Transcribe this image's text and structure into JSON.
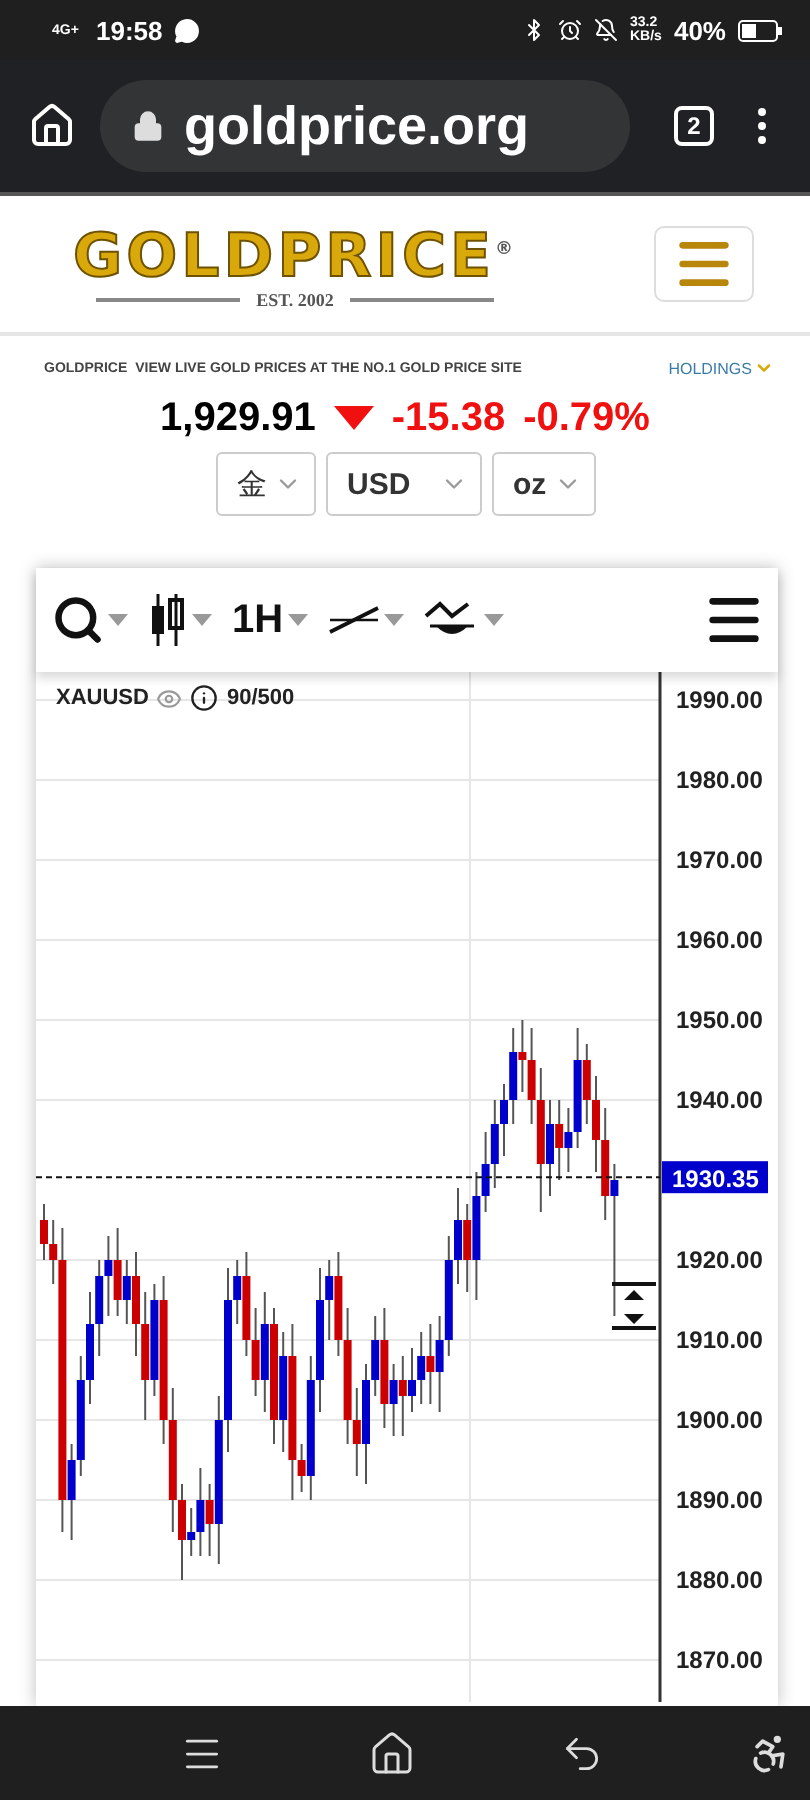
{
  "status_bar": {
    "network": "4G+",
    "time": "19:58",
    "speed": "33.2 KB/s",
    "battery": "40%"
  },
  "browser": {
    "url": "goldprice.org",
    "tab_count": "2"
  },
  "logo": {
    "name": "GOLDPRICE",
    "mark": "®",
    "tagline": "EST. 2002"
  },
  "ticker": {
    "brand": "GOLDPRICE",
    "tagline": "VIEW LIVE GOLD PRICES AT THE NO.1 GOLD PRICE SITE",
    "holdings": "HOLDINGS"
  },
  "quote": {
    "price": "1,929.91",
    "change": "-15.38",
    "percent": "-0.79%"
  },
  "selectors": [
    {
      "value": "金"
    },
    {
      "value": "USD"
    },
    {
      "value": "oz"
    }
  ],
  "toolbar": {
    "interval": "1H"
  },
  "chart": {
    "symbol": "XAUUSD",
    "count": "90/500",
    "chart_data": {
      "type": "candlestick",
      "ylim": [
        1864.75,
        1993.5
      ],
      "grid": true,
      "ref_lines": [
        {
          "axis": "y",
          "value": 1930.35,
          "label": "1930.35"
        }
      ],
      "yticks": [
        {
          "value": 1990,
          "label": "1990.00"
        },
        {
          "value": 1980,
          "label": "1980.00"
        },
        {
          "value": 1970,
          "label": "1970.00"
        },
        {
          "value": 1960,
          "label": "1960.00"
        },
        {
          "value": 1950,
          "label": "1950.00"
        },
        {
          "value": 1940,
          "label": "1940.00"
        },
        {
          "value": 1920,
          "label": "1920.00"
        },
        {
          "value": 1910,
          "label": "1910.00"
        },
        {
          "value": 1900,
          "label": "1900.00"
        },
        {
          "value": 1890,
          "label": "1890.00"
        },
        {
          "value": 1880,
          "label": "1880.00"
        },
        {
          "value": 1870,
          "label": "1870.00"
        }
      ],
      "ohlc": [
        [
          1925,
          1927,
          1920,
          1922
        ],
        [
          1922,
          1925,
          1917,
          1920
        ],
        [
          1920,
          1924,
          1886,
          1890
        ],
        [
          1890,
          1897,
          1885,
          1895
        ],
        [
          1895,
          1908,
          1893,
          1905
        ],
        [
          1905,
          1916,
          1902,
          1912
        ],
        [
          1912,
          1920,
          1908,
          1918
        ],
        [
          1918,
          1923,
          1913,
          1920
        ],
        [
          1920,
          1924,
          1913,
          1915
        ],
        [
          1915,
          1920,
          1912,
          1918
        ],
        [
          1918,
          1921,
          1908,
          1912
        ],
        [
          1912,
          1916,
          1900,
          1905
        ],
        [
          1905,
          1917,
          1903,
          1915
        ],
        [
          1915,
          1918,
          1897,
          1900
        ],
        [
          1900,
          1904,
          1886,
          1890
        ],
        [
          1890,
          1892,
          1880,
          1885
        ],
        [
          1885,
          1889,
          1883,
          1886
        ],
        [
          1886,
          1894,
          1883,
          1890
        ],
        [
          1890,
          1892,
          1883,
          1887
        ],
        [
          1887,
          1903,
          1882,
          1900
        ],
        [
          1900,
          1919,
          1896,
          1915
        ],
        [
          1915,
          1920,
          1912,
          1918
        ],
        [
          1918,
          1921,
          1908,
          1910
        ],
        [
          1910,
          1914,
          1903,
          1905
        ],
        [
          1905,
          1916,
          1901,
          1912
        ],
        [
          1912,
          1914,
          1897,
          1900
        ],
        [
          1900,
          1911,
          1896,
          1908
        ],
        [
          1908,
          1912,
          1890,
          1895
        ],
        [
          1895,
          1897,
          1891,
          1893
        ],
        [
          1893,
          1908,
          1890,
          1905
        ],
        [
          1905,
          1919,
          1901,
          1915
        ],
        [
          1915,
          1920,
          1910,
          1918
        ],
        [
          1918,
          1921,
          1908,
          1910
        ],
        [
          1910,
          1914,
          1897,
          1900
        ],
        [
          1900,
          1904,
          1893,
          1897
        ],
        [
          1897,
          1907,
          1892,
          1905
        ],
        [
          1905,
          1913,
          1903,
          1910
        ],
        [
          1910,
          1914,
          1899,
          1902
        ],
        [
          1902,
          1907,
          1898,
          1905
        ],
        [
          1905,
          1908,
          1898,
          1903
        ],
        [
          1903,
          1909,
          1901,
          1905
        ],
        [
          1905,
          1911,
          1902,
          1908
        ],
        [
          1908,
          1912,
          1902,
          1906
        ],
        [
          1906,
          1913,
          1901,
          1910
        ],
        [
          1910,
          1923,
          1908,
          1920
        ],
        [
          1920,
          1929,
          1917,
          1925
        ],
        [
          1925,
          1927,
          1916,
          1920
        ],
        [
          1920,
          1931,
          1915,
          1928
        ],
        [
          1928,
          1936,
          1926,
          1932
        ],
        [
          1932,
          1940,
          1929,
          1937
        ],
        [
          1937,
          1942,
          1933,
          1940
        ],
        [
          1940,
          1949,
          1937,
          1946
        ],
        [
          1946,
          1950,
          1941,
          1945
        ],
        [
          1945,
          1949,
          1937,
          1940
        ],
        [
          1940,
          1944,
          1926,
          1932
        ],
        [
          1932,
          1940,
          1928,
          1937
        ],
        [
          1937,
          1940,
          1930,
          1934
        ],
        [
          1934,
          1939,
          1931,
          1936
        ],
        [
          1936,
          1949,
          1934,
          1945
        ],
        [
          1945,
          1947,
          1937,
          1940
        ],
        [
          1940,
          1943,
          1931,
          1935
        ],
        [
          1935,
          1939,
          1925,
          1928
        ],
        [
          1928,
          1932,
          1913,
          1930
        ]
      ]
    }
  }
}
